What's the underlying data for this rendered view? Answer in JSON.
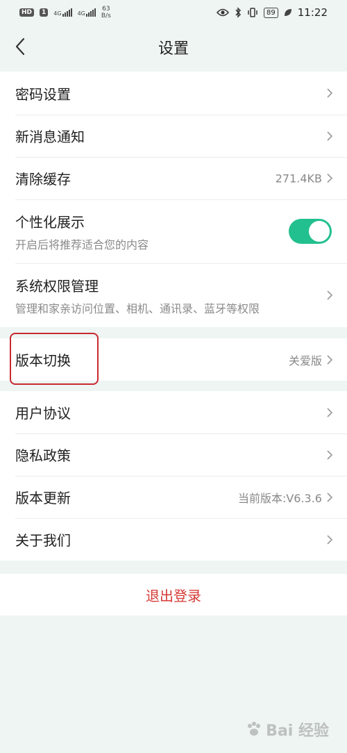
{
  "status_bar": {
    "hd_badge": "HD",
    "sim_slot": "1",
    "network_1": "4G",
    "network_2": "4G",
    "speed_value": "63",
    "speed_unit": "B/s",
    "battery": "89",
    "time": "11:22"
  },
  "header": {
    "title": "设置"
  },
  "group1": {
    "items": [
      {
        "label": "密码设置"
      },
      {
        "label": "新消息通知"
      },
      {
        "label": "清除缓存",
        "value": "271.4KB"
      },
      {
        "label": "个性化展示",
        "sublabel": "开启后将推荐适合您的内容",
        "toggle_on": true
      },
      {
        "label": "系统权限管理",
        "sublabel": "管理和家亲访问位置、相机、通讯录、蓝牙等权限"
      }
    ]
  },
  "group2": {
    "items": [
      {
        "label": "版本切换",
        "value": "关爱版"
      }
    ]
  },
  "group3": {
    "items": [
      {
        "label": "用户协议"
      },
      {
        "label": "隐私政策"
      },
      {
        "label": "版本更新",
        "value": "当前版本:V6.3.6"
      },
      {
        "label": "关于我们"
      }
    ]
  },
  "logout": {
    "label": "退出登录"
  },
  "watermark": {
    "text": "Bai 经验"
  },
  "colors": {
    "background": "#eef5f3",
    "toggle_on": "#22c08e",
    "logout_text": "#d63a35",
    "highlight": "#c8282f"
  }
}
